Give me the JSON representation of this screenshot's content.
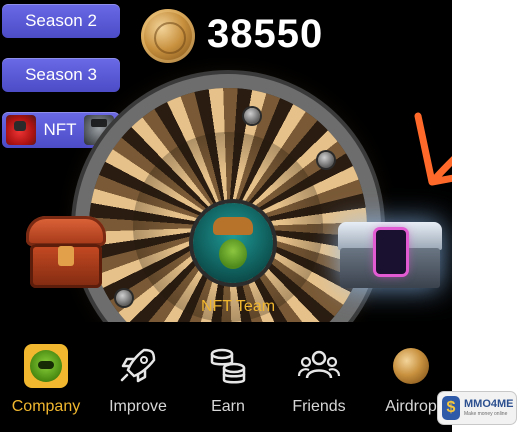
{
  "top_buttons": {
    "season2_label": "Season 2",
    "season3_label": "Season 3",
    "nft_label": "NFT"
  },
  "score": {
    "value": "38550"
  },
  "center": {
    "label": "NFT Team"
  },
  "bottom_nav": {
    "items": [
      {
        "label": "Company",
        "icon": "company-icon",
        "active": true
      },
      {
        "label": "Improve",
        "icon": "rocket-icon"
      },
      {
        "label": "Earn",
        "icon": "coins-stack-icon"
      },
      {
        "label": "Friends",
        "icon": "friends-icon"
      },
      {
        "label": "Airdrop",
        "icon": "coin-icon"
      }
    ]
  },
  "watermark": {
    "main": "MMO4ME",
    "sub": "Make money online"
  },
  "colors": {
    "accent": "#f0b72f",
    "button": "#5b5bd6",
    "background": "#000000",
    "annotation_arrow": "#ff6a2a"
  }
}
